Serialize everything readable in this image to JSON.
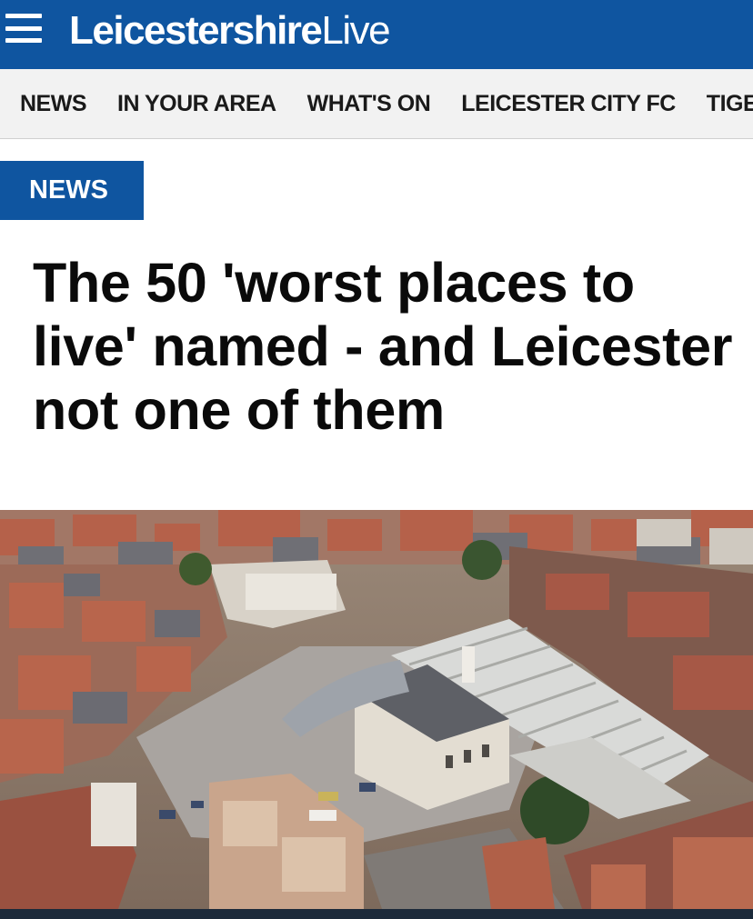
{
  "header": {
    "logo_bold": "Leicestershire",
    "logo_light": "Live",
    "menu_icon": "hamburger-menu-icon",
    "background": "#0f55a0"
  },
  "nav": {
    "items": [
      "NEWS",
      "IN YOUR AREA",
      "WHAT'S ON",
      "LEICESTER CITY FC",
      "TIGE"
    ]
  },
  "article": {
    "section_badge": "NEWS",
    "headline": "The 50 'worst places to live' named - and Leicester not one of them",
    "image_subject": "aerial view of Leicester market square"
  }
}
